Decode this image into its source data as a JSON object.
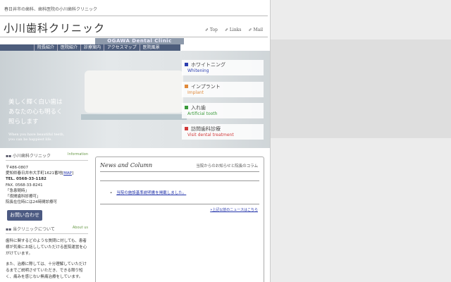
{
  "header": {
    "tagline": "春日井市の歯科、歯科医院の小川歯科クリニック",
    "logo": "小川歯科クリニック",
    "links": [
      "Top",
      "Links",
      "Mail"
    ]
  },
  "brand": "OGAWA Dental Clinic",
  "nav": [
    "院長紹介",
    "医院紹介",
    "診療案内",
    "アクセスマップ",
    "医院風景"
  ],
  "hero": {
    "jp": "美しく輝く白い歯は\nあなたの心も明るく\n照らします",
    "en": "When you have beautiful teeth,\nyou can be happiest life."
  },
  "menu": [
    {
      "jp": "ホワイトニング",
      "en": "Whitening",
      "color": "#2c3fb0"
    },
    {
      "jp": "インプラント",
      "en": "Implant",
      "color": "#e08a3a"
    },
    {
      "jp": "入れ歯",
      "en": "Artificial tooth",
      "color": "#3a9a3a"
    },
    {
      "jp": "訪問歯科診療",
      "en": "Visit dental treatment",
      "color": "#d23a3a"
    }
  ],
  "info": {
    "title": "小川歯科クリニック",
    "en": "Information",
    "zip": "〒486-0807",
    "address": "愛知県春日井市大手町1621番地",
    "map": "MAP",
    "tel": "TEL. 0568-33-1182",
    "fax": "FAX. 0568-33-8241",
    "notes": "「急患随時」\n「夜間歯科診療可」\n院長在住時には24時間診療可",
    "contact": "お問い合わせ"
  },
  "about": {
    "title": "当クリニックについて",
    "en": "About us",
    "p1": "歯科に関するどのような質問に対しても、患者様が気楽にお話ししていただける医院運営を心がけています。",
    "p2": "また、治療に際しては、十分理解していただけるまでご説明させていただき、できる限り短く、痛みを感じない無痛治療をしています。"
  },
  "news": {
    "title": "News and Column",
    "subtitle": "当院からのお知らせと院長のコラム",
    "items": [
      "当院の施設基準説明書を掲載しました。"
    ],
    "more": "»上記以前のニュースはこちら"
  }
}
